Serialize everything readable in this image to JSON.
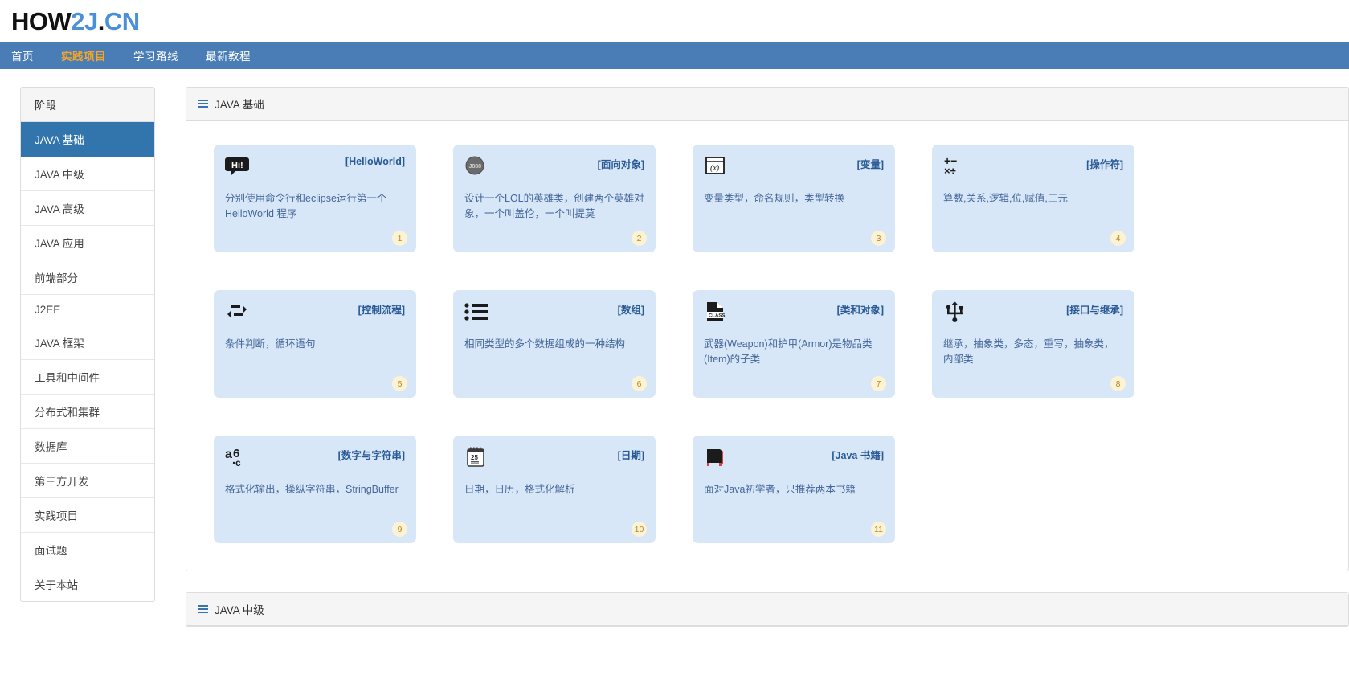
{
  "logo": {
    "part_black_1": "HOW",
    "part_blue_1": "2J",
    "part_black_2": ".",
    "part_blue_2": "CN"
  },
  "nav": {
    "items": [
      {
        "label": "首页",
        "active": false
      },
      {
        "label": "实践项目",
        "active": true
      },
      {
        "label": "学习路线",
        "active": false
      },
      {
        "label": "最新教程",
        "active": false
      }
    ],
    "bar_color": "#4a7db5",
    "active_color": "#f5a623"
  },
  "sidebar": {
    "header": "阶段",
    "items": [
      {
        "label": "JAVA 基础",
        "active": true
      },
      {
        "label": "JAVA 中级",
        "active": false
      },
      {
        "label": "JAVA 高级",
        "active": false
      },
      {
        "label": "JAVA 应用",
        "active": false
      },
      {
        "label": "前端部分",
        "active": false
      },
      {
        "label": "J2EE",
        "active": false
      },
      {
        "label": "JAVA 框架",
        "active": false
      },
      {
        "label": "工具和中间件",
        "active": false
      },
      {
        "label": "分布式和集群",
        "active": false
      },
      {
        "label": "数据库",
        "active": false
      },
      {
        "label": "第三方开发",
        "active": false
      },
      {
        "label": "实践项目",
        "active": false
      },
      {
        "label": "面试题",
        "active": false
      },
      {
        "label": "关于本站",
        "active": false
      }
    ],
    "active_bg": "#3274ac"
  },
  "panels": [
    {
      "title": "JAVA 基础",
      "rows": [
        [
          {
            "icon": "speech-bubble-hi-icon",
            "title": "[HelloWorld]",
            "desc": "分别使用命令行和eclipse运行第一个 HelloWorld 程序",
            "num": "1"
          },
          {
            "icon": "object-circle-icon",
            "title": "[面向对象]",
            "desc": "设计一个LOL的英雄类，创建两个英雄对象，一个叫盖伦，一个叫提莫",
            "num": "2"
          },
          {
            "icon": "variable-box-icon",
            "title": "[变量]",
            "desc": "变量类型，命名规则，类型转换",
            "num": "3"
          },
          {
            "icon": "math-operators-icon",
            "title": "[操作符]",
            "desc": "算数,关系,逻辑,位,赋值,三元",
            "num": "4"
          }
        ],
        [
          {
            "icon": "loop-arrows-icon",
            "title": "[控制流程]",
            "desc": "条件判断，循环语句",
            "num": "5"
          },
          {
            "icon": "bullet-list-icon",
            "title": "[数组]",
            "desc": "相同类型的多个数据组成的一种结构",
            "num": "6"
          },
          {
            "icon": "class-file-icon",
            "title": "[类和对象]",
            "desc": "武器(Weapon)和护甲(Armor)是物品类(Item)的子类",
            "num": "7"
          },
          {
            "icon": "inheritance-trident-icon",
            "title": "[接口与继承]",
            "desc": "继承，抽象类，多态，重写，抽象类，内部类",
            "num": "8"
          }
        ],
        [
          {
            "icon": "abc-letters-icon",
            "title": "[数字与字符串]",
            "desc": "格式化输出，操纵字符串，StringBuffer",
            "num": "9"
          },
          {
            "icon": "calendar-icon",
            "title": "[日期]",
            "desc": "日期，日历，格式化解析",
            "num": "10"
          },
          {
            "icon": "book-icon",
            "title": "[Java 书籍]",
            "desc": "面对Java初学者，只推荐两本书籍",
            "num": "11"
          }
        ]
      ]
    },
    {
      "title": "JAVA 中级",
      "rows": []
    }
  ],
  "colors": {
    "card_bg": "#d7e7f7",
    "card_title": "#2a5a96",
    "card_desc": "#44669a",
    "badge_bg": "#fdf3d2",
    "badge_text": "#b08a3a"
  }
}
